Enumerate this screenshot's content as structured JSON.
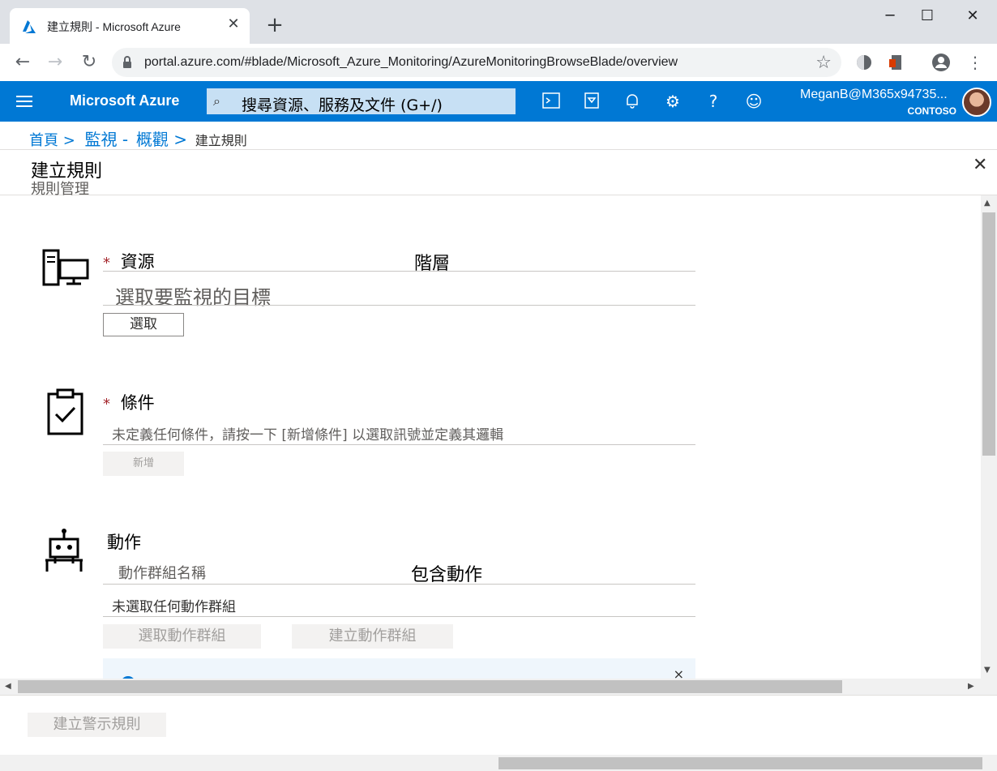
{
  "browser": {
    "tab_title": "建立規則 -  Microsoft Azure",
    "tab_close": "✕",
    "new_tab": "+",
    "url": "portal.azure.com/#blade/Microsoft_Azure_Monitoring/AzureMonitoringBrowseBlade/overview",
    "window_controls": {
      "minimize": "─",
      "maximize": "☐",
      "close": "✕"
    }
  },
  "azure": {
    "brand": "Microsoft Azure",
    "search_placeholder": "搜尋資源、服務及文件 (G+/)",
    "user_name": "MeganB@M365x94735...",
    "user_org": "CONTOSO"
  },
  "breadcrumb": {
    "items": [
      "首頁 >",
      "監視 -",
      "概觀 >"
    ],
    "current": "建立規則"
  },
  "blade": {
    "title": "建立規則",
    "subtitle": "規則管理",
    "close": "✕"
  },
  "resource": {
    "required_mark": "*",
    "label": "資源",
    "col_hierarchy": "階層",
    "placeholder": "選取要監視的目標",
    "select_button": "選取"
  },
  "condition": {
    "required_mark": "*",
    "label": "條件",
    "help": "未定義任何條件，請按一下 [新增條件] 以選取訊號並定義其邏輯",
    "add_button": "新增"
  },
  "actions": {
    "label": "動作",
    "col_name": "動作群組名稱",
    "col_contains": "包含動作",
    "empty": "未選取任何動作群組",
    "select_button": "選取動作群組",
    "create_button": "建立動作群組",
    "info_close": "×"
  },
  "footer": {
    "create_rule_button": "建立警示規則"
  }
}
